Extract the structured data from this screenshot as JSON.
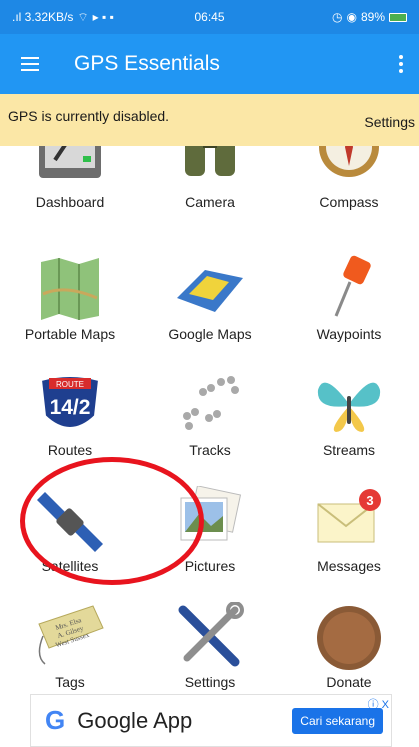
{
  "status_bar": {
    "network": ".ıl 3.32KB/s",
    "time": "06:45",
    "battery": "89%"
  },
  "app_bar": {
    "title": "GPS Essentials"
  },
  "banner": {
    "message": "GPS is currently disabled.",
    "action": "Settings"
  },
  "tiles": [
    {
      "label": "Dashboard",
      "icon": "dashboard-icon"
    },
    {
      "label": "Camera",
      "icon": "binoculars-icon"
    },
    {
      "label": "Compass",
      "icon": "compass-icon"
    },
    {
      "label": "Portable Maps",
      "icon": "folded-map-icon"
    },
    {
      "label": "Google Maps",
      "icon": "map-icon"
    },
    {
      "label": "Waypoints",
      "icon": "pushpin-icon"
    },
    {
      "label": "Routes",
      "icon": "route-shield-icon",
      "badge_text": "14/2",
      "badge_top": "ROUTE"
    },
    {
      "label": "Tracks",
      "icon": "paw-tracks-icon"
    },
    {
      "label": "Streams",
      "icon": "butterfly-icon"
    },
    {
      "label": "Satellites",
      "icon": "satellite-icon"
    },
    {
      "label": "Pictures",
      "icon": "photos-icon"
    },
    {
      "label": "Messages",
      "icon": "envelope-icon",
      "badge": "3"
    },
    {
      "label": "Tags",
      "icon": "tag-icon",
      "tag_text": "Mrs. Elsa\nA. Gilsey\nWest Sussex"
    },
    {
      "label": "Settings",
      "icon": "tools-icon"
    },
    {
      "label": "Donate",
      "icon": "coin-icon"
    }
  ],
  "ad": {
    "logo": "G",
    "title": "Google App",
    "button": "Cari sekarang",
    "info": "ⓘ X"
  },
  "colors": {
    "status_bar": "#1e88e5",
    "app_bar": "#2196f3",
    "banner": "#fbe7a6",
    "highlight": "#e8141e",
    "badge": "#e53935"
  }
}
